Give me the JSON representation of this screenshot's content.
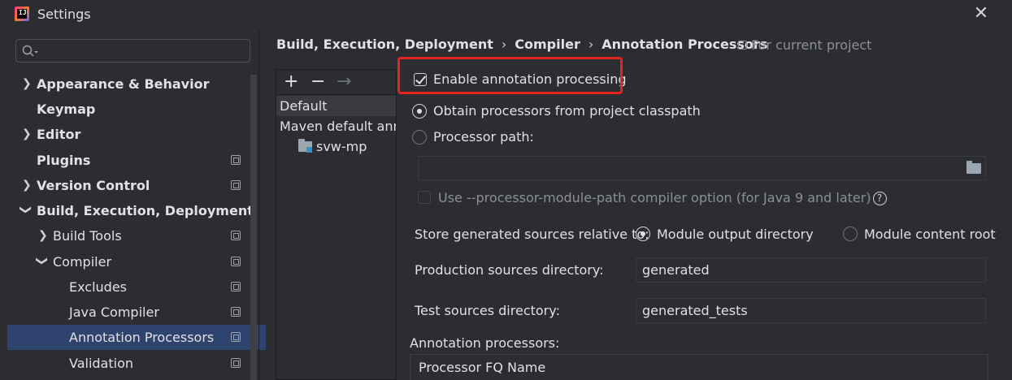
{
  "window": {
    "title": "Settings",
    "logo_text": "IJ"
  },
  "sidebar": {
    "items": [
      {
        "label": "Appearance & Behavior"
      },
      {
        "label": "Keymap"
      },
      {
        "label": "Editor"
      },
      {
        "label": "Plugins"
      },
      {
        "label": "Version Control"
      },
      {
        "label": "Build, Execution, Deployment"
      },
      {
        "label": "Build Tools"
      },
      {
        "label": "Compiler"
      },
      {
        "label": "Excludes"
      },
      {
        "label": "Java Compiler"
      },
      {
        "label": "Annotation Processors"
      },
      {
        "label": "Validation"
      }
    ]
  },
  "breadcrumb": {
    "items": [
      "Build, Execution, Deployment",
      "Compiler",
      "Annotation Processors"
    ],
    "separator": "›",
    "scope": "For current project"
  },
  "profiles": {
    "toolbar": {
      "add": "+",
      "remove": "−",
      "move": "→"
    },
    "items": [
      {
        "label": "Default"
      },
      {
        "label": "Maven default annotation processors profile"
      },
      {
        "label": "svw-mp"
      }
    ]
  },
  "settings": {
    "enable_annotation_processing": "Enable annotation processing",
    "obtain_from_classpath": "Obtain processors from project classpath",
    "processor_path": "Processor path:",
    "processor_path_value": "",
    "module_path_option": "Use --processor-module-path compiler option (for Java 9 and later)",
    "store_relative_to": "Store generated sources relative to:",
    "module_output_directory": "Module output directory",
    "module_content_root": "Module content root",
    "production_sources_label": "Production sources directory:",
    "production_sources_value": "generated",
    "test_sources_label": "Test sources directory:",
    "test_sources_value": "generated_tests",
    "annotation_processors_label": "Annotation processors:",
    "table_header": "Processor FQ Name"
  },
  "colors": {
    "highlight": "#e5231f",
    "selection": "#2e436e"
  }
}
